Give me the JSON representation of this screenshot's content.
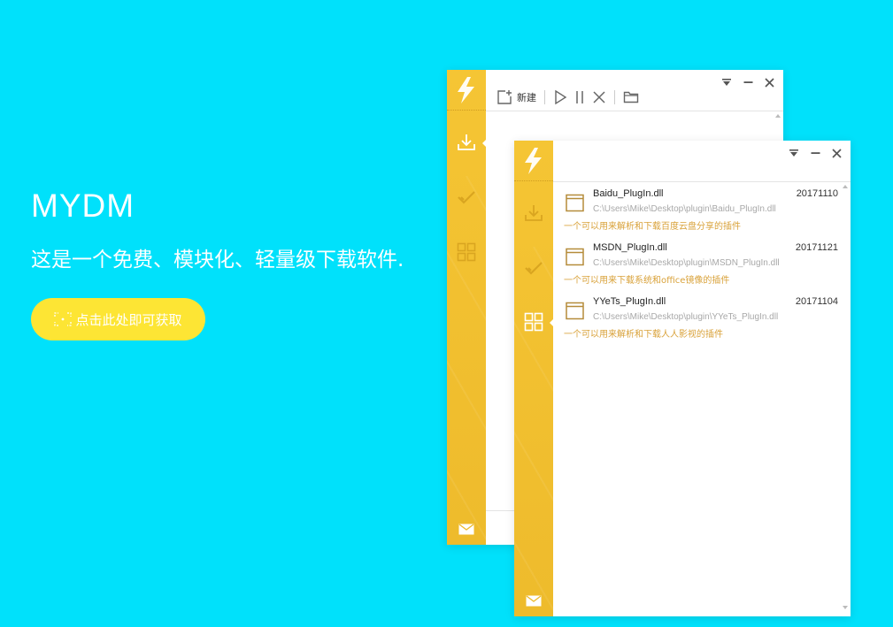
{
  "hero": {
    "title": "MYDM",
    "subtitle": "这是一个免费、模块化、轻量级下载软件.",
    "cta_label": "点击此处即可获取"
  },
  "back_window": {
    "toolbar": {
      "new_label": "新建"
    }
  },
  "front_window": {
    "plugins": [
      {
        "name": "Baidu_PlugIn.dll",
        "date": "20171110",
        "path": "C:\\Users\\Mike\\Desktop\\plugin\\Baidu_PlugIn.dll",
        "desc": "一个可以用来解析和下载百度云盘分享的插件"
      },
      {
        "name": "MSDN_PlugIn.dll",
        "date": "20171121",
        "path": "C:\\Users\\Mike\\Desktop\\plugin\\MSDN_PlugIn.dll",
        "desc": "一个可以用来下载系统和office镜像的插件"
      },
      {
        "name": "YYeTs_PlugIn.dll",
        "date": "20171104",
        "path": "C:\\Users\\Mike\\Desktop\\plugin\\YYeTs_PlugIn.dll",
        "desc": "一个可以用来解析和下载人人影视的插件"
      }
    ]
  },
  "icons": {
    "logo": "lightning-icon",
    "download": "download-icon",
    "completed": "check-icon",
    "plugins": "grid-icon",
    "mail": "mail-icon"
  },
  "colors": {
    "background": "#00e1fb",
    "sidebar": "#f5c534",
    "cta": "#fde534",
    "desc_text": "#d9a23a"
  }
}
